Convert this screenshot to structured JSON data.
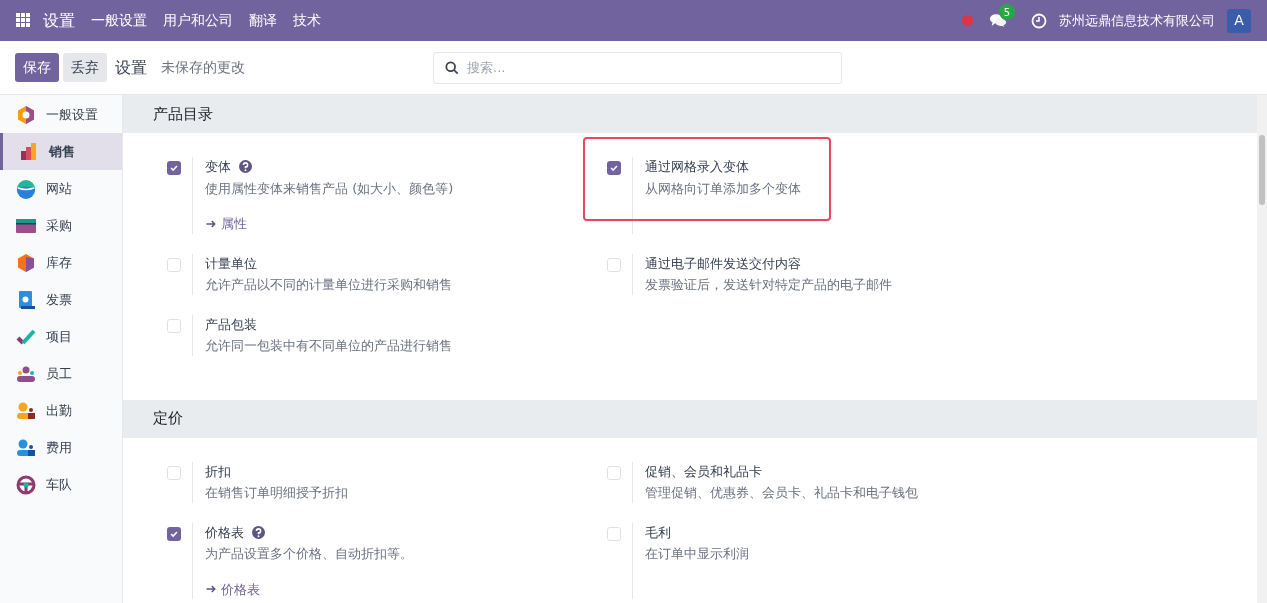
{
  "topbar": {
    "app_title": "设置",
    "menu": [
      "一般设置",
      "用户和公司",
      "翻译",
      "技术"
    ],
    "message_count": "5",
    "company": "苏州远鼎信息技术有限公司",
    "avatar": "A"
  },
  "control_bar": {
    "save": "保存",
    "discard": "丢弃",
    "breadcrumb": "设置",
    "status": "未保存的更改",
    "search": {
      "placeholder": "搜索..."
    }
  },
  "sidebar": {
    "items": [
      {
        "label": "一般设置",
        "selected": false
      },
      {
        "label": "销售",
        "selected": true
      },
      {
        "label": "网站",
        "selected": false
      },
      {
        "label": "采购",
        "selected": false
      },
      {
        "label": "库存",
        "selected": false
      },
      {
        "label": "发票",
        "selected": false
      },
      {
        "label": "项目",
        "selected": false
      },
      {
        "label": "员工",
        "selected": false
      },
      {
        "label": "出勤",
        "selected": false
      },
      {
        "label": "费用",
        "selected": false
      },
      {
        "label": "车队",
        "selected": false
      }
    ]
  },
  "sections": [
    {
      "title": "产品目录",
      "settings": [
        {
          "title": "变体",
          "help": true,
          "description": "使用属性变体来销售产品 (如大小、颜色等)",
          "checked": true,
          "highlighted": false,
          "link": "属性"
        },
        {
          "title": "通过网格录入变体",
          "help": false,
          "description": "从网格向订单添加多个变体",
          "checked": true,
          "highlighted": true
        },
        {
          "title": "计量单位",
          "help": false,
          "description": "允许产品以不同的计量单位进行采购和销售",
          "checked": false,
          "highlighted": false
        },
        {
          "title": "通过电子邮件发送交付内容",
          "help": false,
          "description": "发票验证后，发送针对特定产品的电子邮件",
          "checked": false,
          "highlighted": false
        },
        {
          "title": "产品包装",
          "help": false,
          "description": "允许同一包装中有不同单位的产品进行销售",
          "checked": false,
          "highlighted": false
        }
      ]
    },
    {
      "title": "定价",
      "settings": [
        {
          "title": "折扣",
          "help": false,
          "description": "在销售订单明细授予折扣",
          "checked": false,
          "highlighted": false
        },
        {
          "title": "促销、会员和礼品卡",
          "help": false,
          "description": "管理促销、优惠券、会员卡、礼品卡和电子钱包",
          "checked": false,
          "highlighted": false
        },
        {
          "title": "价格表",
          "help": true,
          "description": "为产品设置多个价格、自动折扣等。",
          "checked": true,
          "highlighted": false,
          "link": "价格表"
        },
        {
          "title": "毛利",
          "help": false,
          "description": "在订单中显示利润",
          "checked": false,
          "highlighted": false
        }
      ]
    }
  ]
}
